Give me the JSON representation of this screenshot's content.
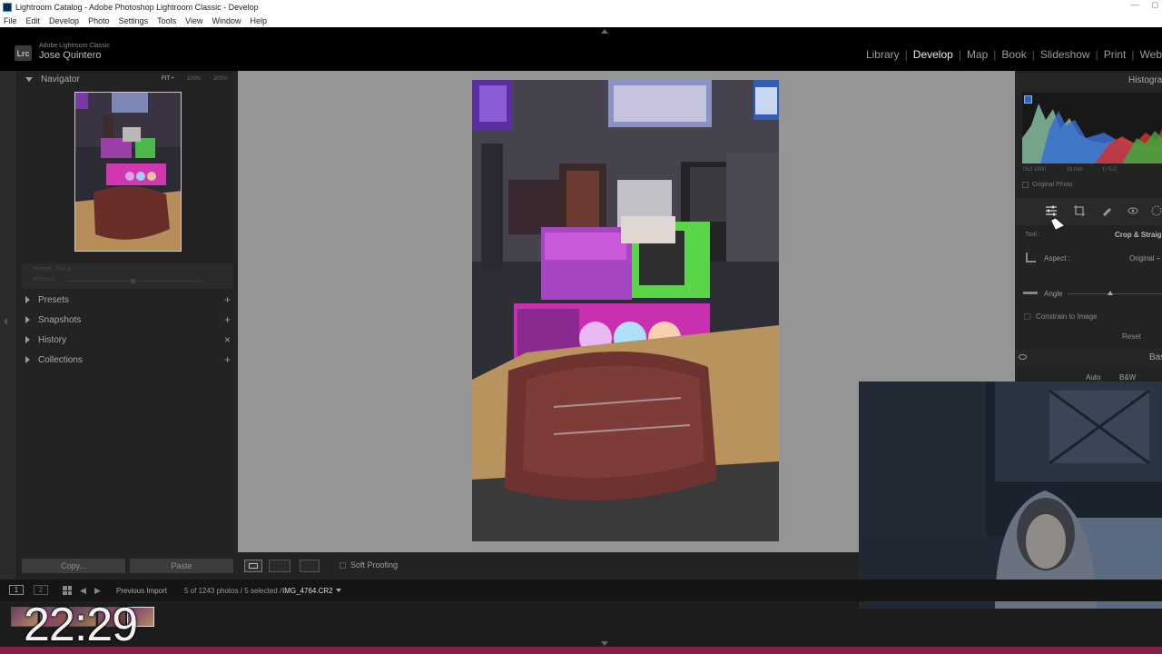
{
  "window": {
    "title": "Lightroom Catalog - Adobe Photoshop Lightroom Classic - Develop",
    "controls": [
      "—",
      "◻"
    ]
  },
  "menu": [
    "File",
    "Edit",
    "Develop",
    "Photo",
    "Settings",
    "Tools",
    "View",
    "Window",
    "Help"
  ],
  "identity": {
    "logo": "Lrc",
    "app_name": "Adobe Lightroom Classic",
    "user": "Jose Quintero"
  },
  "modules": [
    {
      "label": "Library",
      "active": false
    },
    {
      "label": "Develop",
      "active": true
    },
    {
      "label": "Map",
      "active": false
    },
    {
      "label": "Book",
      "active": false
    },
    {
      "label": "Slideshow",
      "active": false
    },
    {
      "label": "Print",
      "active": false
    },
    {
      "label": "Web",
      "active": false
    }
  ],
  "left_panel": {
    "navigator": {
      "title": "Navigator",
      "zoom_fit": "FIT ÷",
      "zoom_100": "100%",
      "zoom_200": "200%"
    },
    "preset_strip": {
      "line1": "Preset : None",
      "line2": "Amount"
    },
    "sections": [
      {
        "label": "Presets",
        "action": "+"
      },
      {
        "label": "Snapshots",
        "action": "+"
      },
      {
        "label": "History",
        "action": "×"
      },
      {
        "label": "Collections",
        "action": "+"
      }
    ],
    "copy_label": "Copy...",
    "paste_label": "Paste"
  },
  "toolbar": {
    "soft_proofing": "Soft Proofing"
  },
  "right_panel": {
    "histogram_title": "Histogram",
    "exif": {
      "iso": "ISO 1600",
      "focal": "18 mm",
      "aperture": "f / 5.0"
    },
    "original_photo": "Original Photo",
    "tool_label": "Tool :",
    "crop_title": "Crop & Straighten",
    "aspect_label": "Aspect :",
    "aspect_value": "Original ÷",
    "angle_label": "Angle",
    "constrain_label": "Constrain to Image",
    "reset_label": "Reset",
    "basic_title": "Basic",
    "auto_label": "Auto",
    "bw_label": "B&W"
  },
  "filmstrip": {
    "monitor1": "1",
    "monitor2": "2",
    "source": "Previous Import",
    "selection_info": "5 of 1243 photos / 5 selected /",
    "selected_file": "IMG_4764.CR2",
    "clock": "22:29"
  },
  "colors": {
    "accent_magenta": "#8a1b4d",
    "histogram_blue": "#1d6ad6"
  }
}
